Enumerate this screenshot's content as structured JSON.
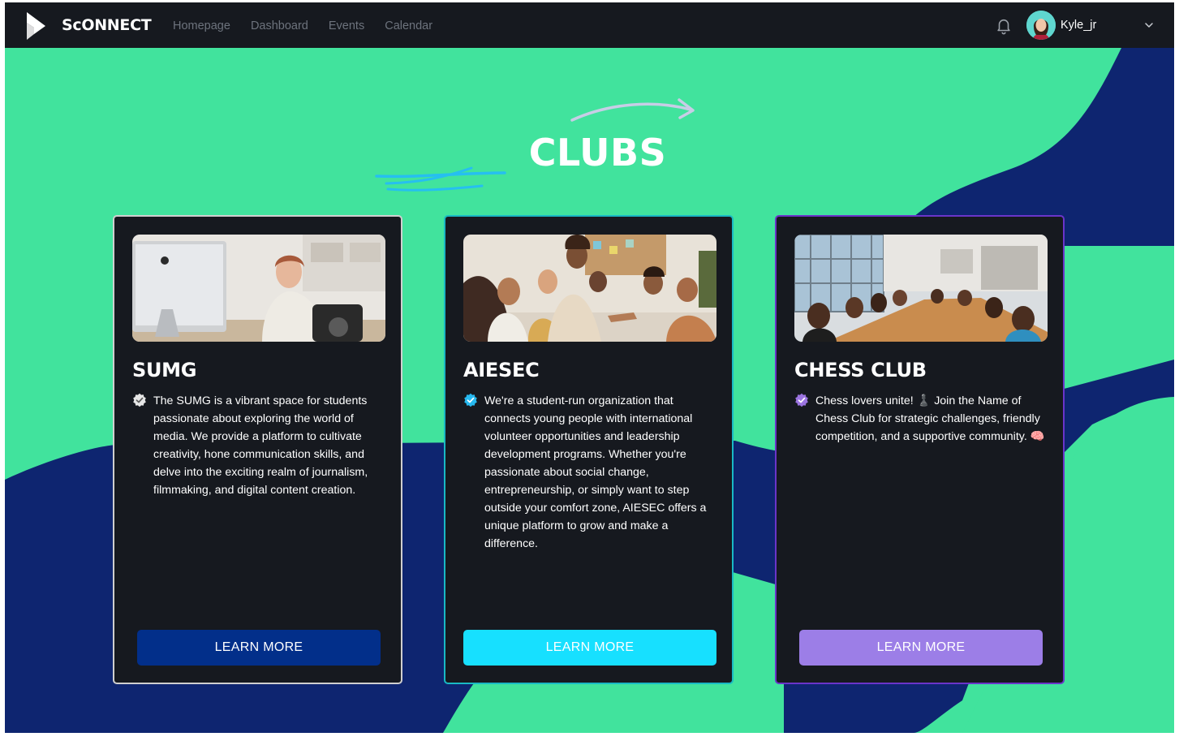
{
  "nav": {
    "brand": "ScONNECT",
    "links": [
      "Homepage",
      "Dashboard",
      "Events",
      "Calendar"
    ],
    "username": "Kyle_jr"
  },
  "page": {
    "heading": "CLUBS"
  },
  "colors": {
    "navbar_bg": "#16191f",
    "bg_green": "#41e39d",
    "bg_navy": "#0e2570",
    "card_bg": "#16191f",
    "sumg_button": "#022f8a",
    "aiesec_button": "#17e0ff",
    "chess_button": "#9c7ee7"
  },
  "clubs": [
    {
      "name": "SUMG",
      "description": "The SUMG is a vibrant space for students passionate about exploring the world of media. We provide a platform to cultivate creativity, hone communication skills, and delve into the exciting realm of journalism, filmmaking, and digital content creation.",
      "icon": "white-verified-badge-icon",
      "button": "LEARN MORE"
    },
    {
      "name": "AIESEC",
      "description": "We're a student-run organization that connects young people with international volunteer opportunities and leadership development programs. Whether you're passionate about social change, entrepreneurship, or simply want to step outside your comfort zone, AIESEC offers a unique platform to grow and make a difference.",
      "icon": "cyan-verified-badge-icon",
      "button": "LEARN MORE"
    },
    {
      "name": "CHESS CLUB",
      "description": "Chess lovers unite! ♟️ Join the Name of Chess Club for strategic challenges, friendly competition, and a supportive community. 🧠",
      "icon": "purple-verified-badge-icon",
      "button": "LEARN MORE"
    }
  ]
}
